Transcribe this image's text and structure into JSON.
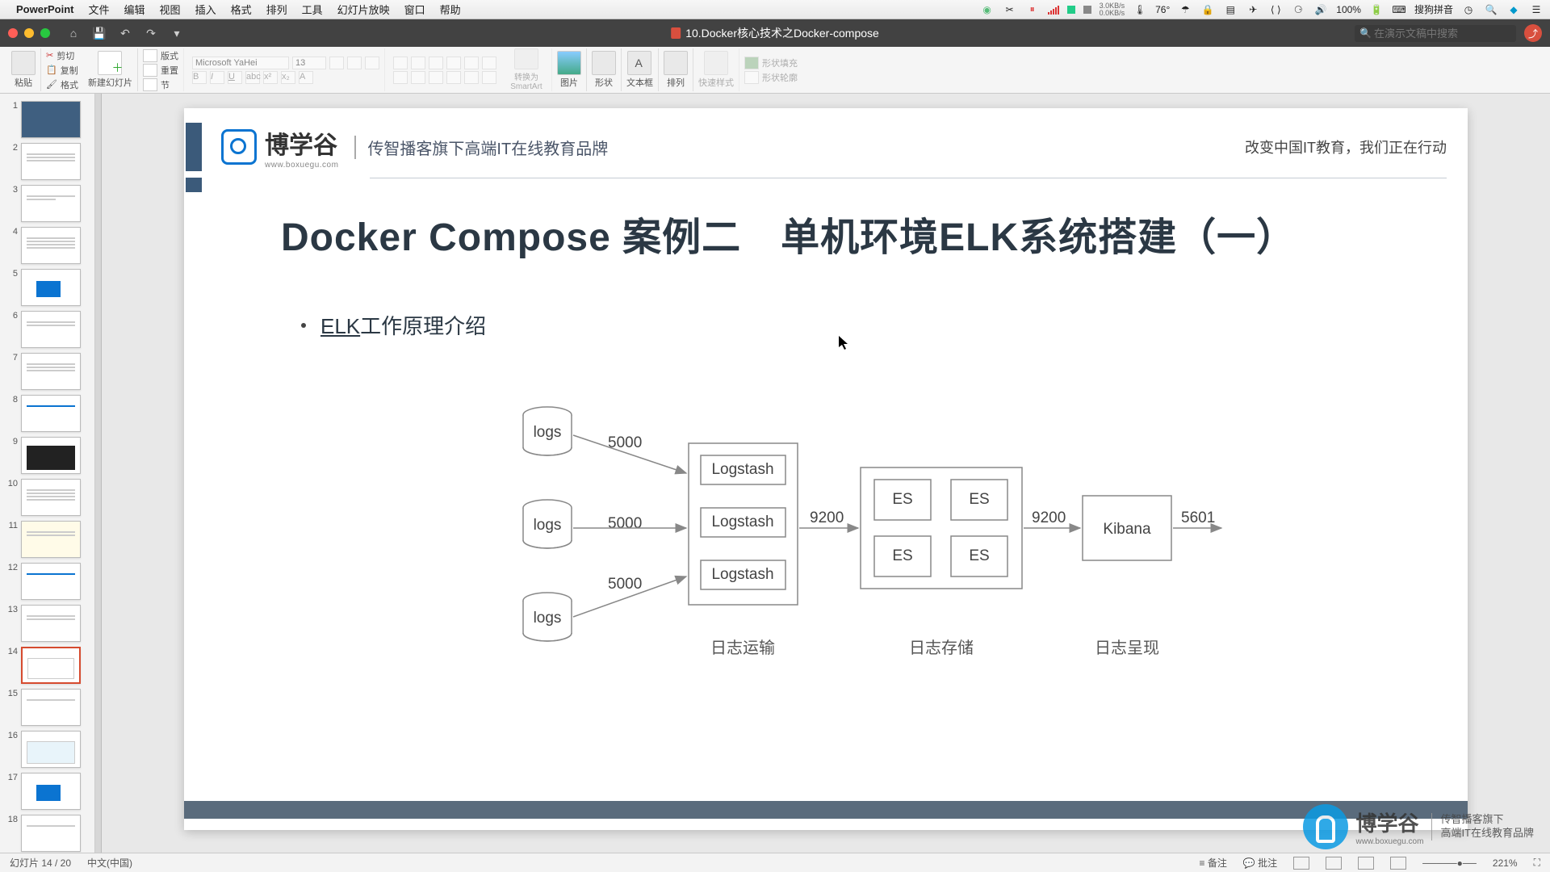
{
  "mac_menu": {
    "app": "PowerPoint",
    "items": [
      "文件",
      "编辑",
      "视图",
      "插入",
      "格式",
      "排列",
      "工具",
      "幻灯片放映",
      "窗口",
      "帮助"
    ]
  },
  "mac_right": {
    "net_down": "3.0KB/s",
    "net_up": "0.0KB/s",
    "temp": "76°",
    "battery": "100%",
    "ime": "搜狗拼音"
  },
  "title": {
    "doc": "10.Docker核心技术之Docker-compose",
    "search_placeholder": "在演示文稿中搜索"
  },
  "ribbon": {
    "paste": "粘贴",
    "cut": "剪切",
    "copy": "复制",
    "format_painter": "格式",
    "new_slide": "新建幻灯片",
    "layout": "版式",
    "reset": "重置",
    "section": "节",
    "font_name": "Microsoft YaHei",
    "font_size": "13",
    "convert_smartart": "转换为SmartArt",
    "picture": "图片",
    "shapes": "形状",
    "textbox": "文本框",
    "arrange": "排列",
    "quick_styles": "快速样式",
    "shape_fill": "形状填充",
    "shape_outline": "形状轮廓"
  },
  "slide": {
    "logo_main": "博学谷",
    "logo_sub": "www.boxuegu.com",
    "logo_tag": "传智播客旗下高端IT在线教育品牌",
    "logo_right": "改变中国IT教育，我们正在行动",
    "title": "Docker Compose 案例二　单机环境ELK系统搭建（一）",
    "bullet_ul": "ELK",
    "bullet_rest": "工作原理介绍",
    "diagram": {
      "cyl": "logs",
      "port_in": "5000",
      "logstash": "Logstash",
      "port_es": "9200",
      "es": "ES",
      "port_kb": "9200",
      "kibana": "Kibana",
      "port_out": "5601",
      "lbl_transport": "日志运输",
      "lbl_store": "日志存储",
      "lbl_present": "日志呈现"
    }
  },
  "watermark": {
    "main": "博学谷",
    "sub": "www.boxuegu.com",
    "tag1": "传智播客旗下",
    "tag2": "高端IT在线教育品牌"
  },
  "status": {
    "slide": "幻灯片 14 / 20",
    "lang": "中文(中国)",
    "notes": "备注",
    "comments": "批注",
    "zoom": "221%"
  },
  "thumbs_total": 18,
  "thumbs_selected": 14
}
